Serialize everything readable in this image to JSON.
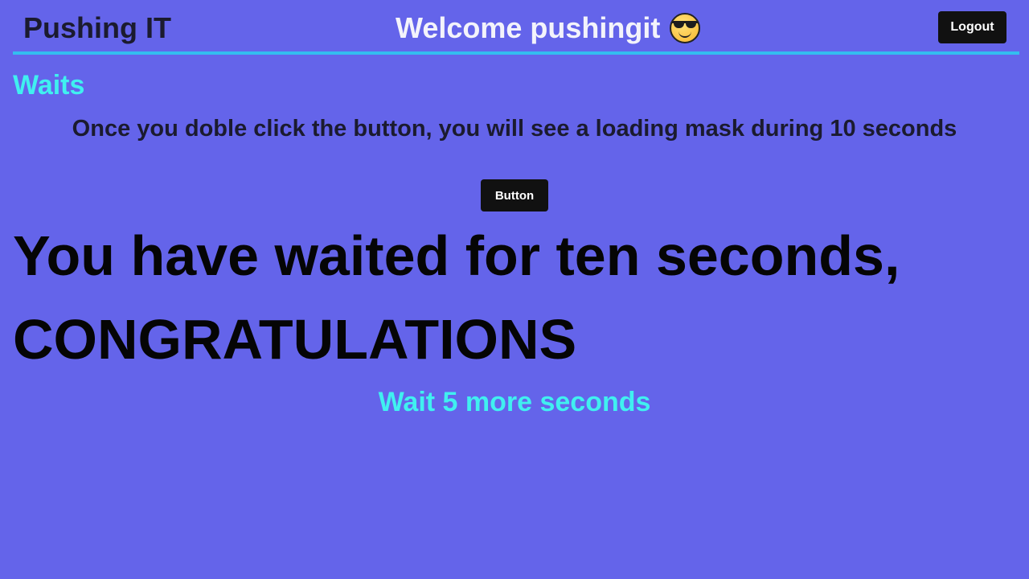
{
  "header": {
    "brand": "Pushing IT",
    "welcome": "Welcome pushingit",
    "emoji_icon": "smiling-face-with-sunglasses-icon",
    "logout_label": "Logout"
  },
  "main": {
    "section_title": "Waits",
    "description": "Once you doble click the button, you will see a loading mask during 10 seconds",
    "button_label": "Button",
    "result_line1": "You have waited for ten seconds,",
    "result_line2": "CONGRATULATIONS",
    "wait_more": "Wait 5 more seconds"
  },
  "colors": {
    "background": "#6464ea",
    "header_rule": "#33bdf0",
    "accent_cyan": "#40f0f0",
    "button_bg": "#111111",
    "button_text": "#ffffff",
    "dark_text": "#1b1b2f",
    "result_text": "#050505",
    "welcome_text": "#f3f3fb"
  }
}
